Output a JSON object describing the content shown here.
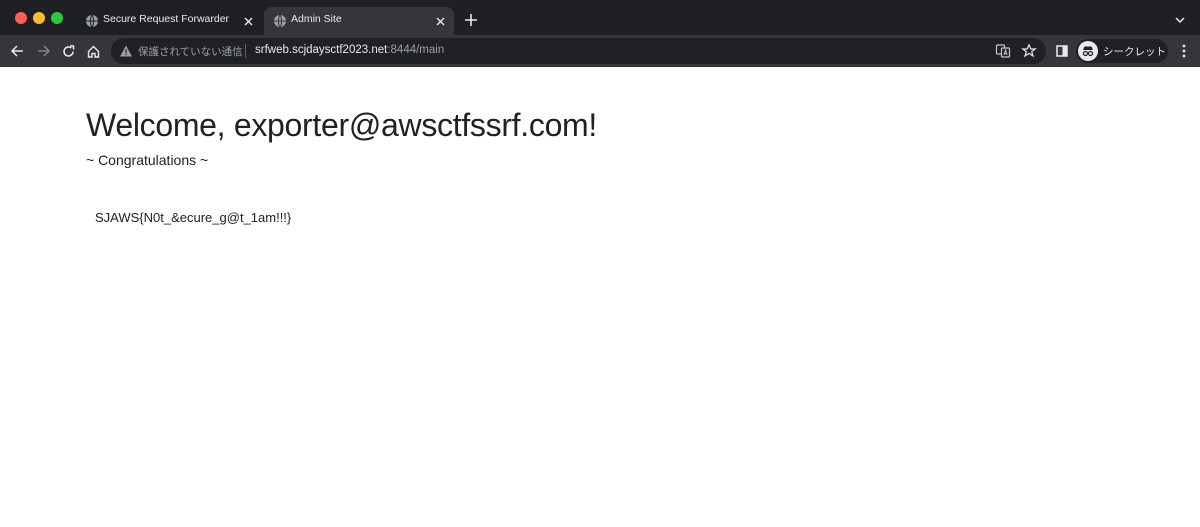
{
  "browser": {
    "tabs": [
      {
        "label": "Secure Request Forwarder",
        "active": false
      },
      {
        "label": "Admin Site",
        "active": true
      }
    ],
    "address_bar": {
      "security_label": "保護されていない通信",
      "url_host": "srfweb.scjdaysctf2023.net",
      "url_rest": ":8444/main"
    },
    "profile": {
      "label": "シークレット"
    },
    "icons": {
      "back": "arrow-left-icon",
      "forward": "arrow-right-icon",
      "reload": "reload-icon",
      "home": "home-icon",
      "warning": "warning-triangle-icon",
      "translate": "translate-icon",
      "bookmark": "star-icon",
      "side_panel": "side-panel-icon",
      "menu": "kebab-menu-icon"
    },
    "colors": {
      "frame": "#1f2023",
      "toolbar": "#35363a",
      "omnibox": "#202124",
      "traffic_close": "#ff5f57",
      "traffic_minimize": "#febc2e",
      "traffic_maximize": "#28c840"
    }
  },
  "page": {
    "heading": "Welcome, exporter@awsctfssrf.com!",
    "subtitle": "~ Congratulations ~",
    "flag": "SJAWS{N0t_&ecure_g@t_1am!!!}"
  }
}
